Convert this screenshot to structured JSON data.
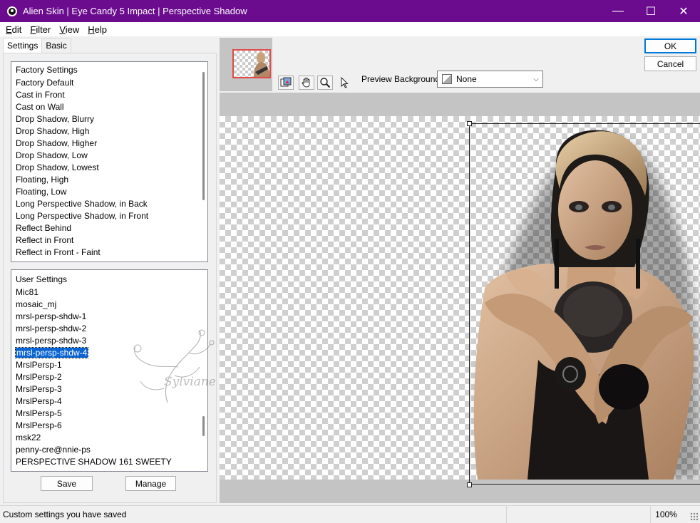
{
  "window": {
    "title": "Alien Skin | Eye Candy 5 Impact | Perspective Shadow",
    "minimize": "—",
    "maximize": "☐",
    "close": "✕"
  },
  "menu": [
    {
      "accel": "E",
      "rest": "dit"
    },
    {
      "accel": "F",
      "rest": "ilter"
    },
    {
      "accel": "V",
      "rest": "iew"
    },
    {
      "accel": "H",
      "rest": "elp"
    }
  ],
  "tabs": {
    "settings": "Settings",
    "basic": "Basic"
  },
  "factory_settings": {
    "header": "Factory Settings",
    "items": [
      "Factory Default",
      "Cast in Front",
      "Cast on Wall",
      "Drop Shadow, Blurry",
      "Drop Shadow, High",
      "Drop Shadow, Higher",
      "Drop Shadow, Low",
      "Drop Shadow, Lowest",
      "Floating, High",
      "Floating, Low",
      "Long Perspective Shadow, in Back",
      "Long Perspective Shadow, in Front",
      "Reflect Behind",
      "Reflect in Front",
      "Reflect in Front - Faint"
    ]
  },
  "user_settings": {
    "header": "User Settings",
    "items": [
      "Mic81",
      "mosaic_mj",
      "mrsl-persp-shdw-1",
      "mrsl-persp-shdw-2",
      "mrsl-persp-shdw-3",
      "mrsl-persp-shdw-4",
      "MrslPersp-1",
      "MrslPersp-2",
      "MrslPersp-3",
      "MrslPersp-4",
      "MrslPersp-5",
      "MrslPersp-6",
      "msk22",
      "penny-cre@nnie-ps",
      "PERSPECTIVE SHADOW 161 SWEETY"
    ],
    "selected": "mrsl-persp-shdw-4"
  },
  "buttons": {
    "save": "Save",
    "manage": "Manage",
    "ok": "OK",
    "cancel": "Cancel"
  },
  "preview": {
    "background_label": "Preview Background:",
    "background_value": "None"
  },
  "watermark": "Sylviane",
  "status": {
    "message": "Custom settings you have saved",
    "zoom": "100%"
  },
  "colors": {
    "titlebar": "#6b0c8f",
    "selection": "#0a64d2",
    "accent": "#0078d7"
  }
}
